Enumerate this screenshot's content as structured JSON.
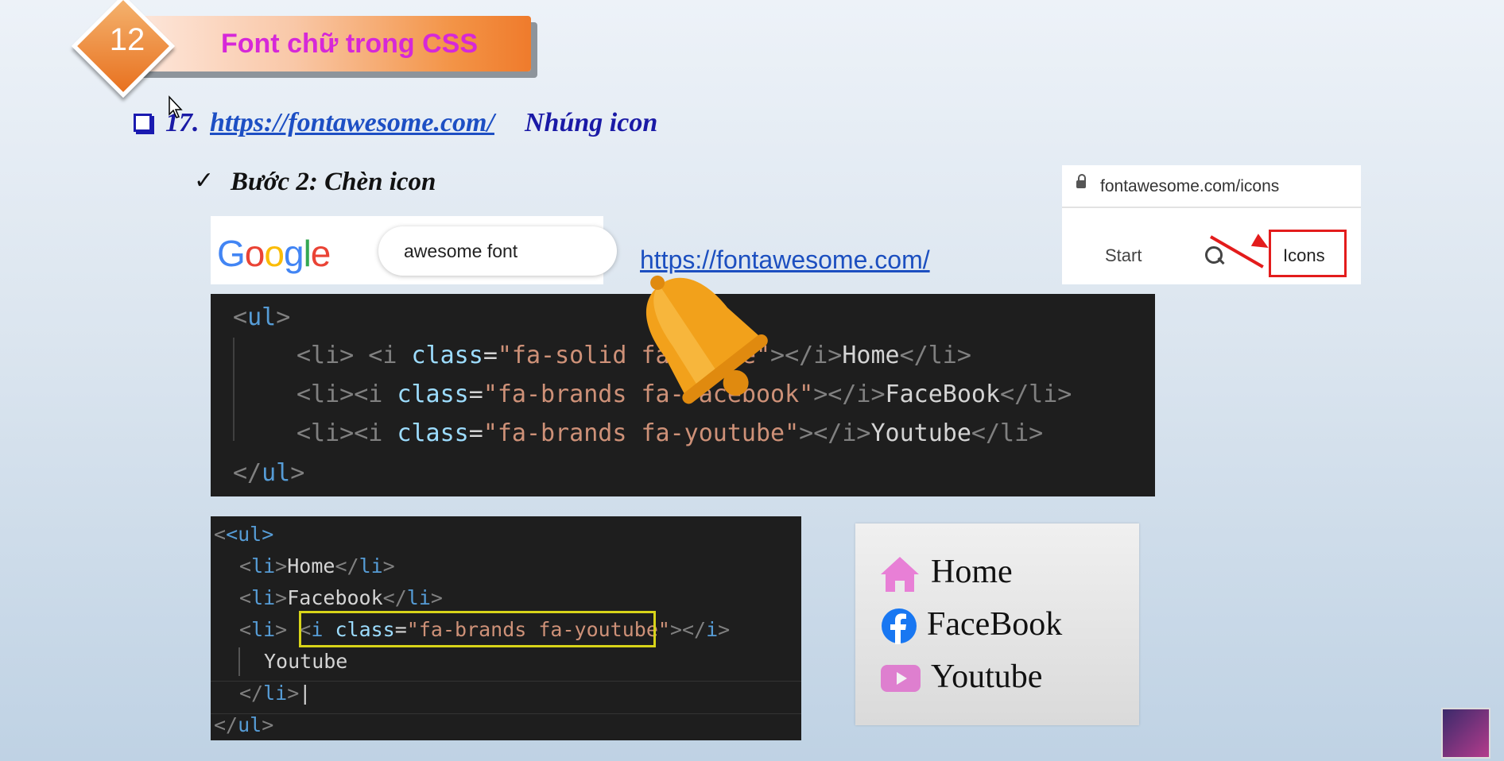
{
  "slide": {
    "number": "12",
    "title": "Font chữ trong CSS",
    "heading_number": "17.",
    "heading_link": "https://fontawesome.com/",
    "heading_rest": "Nhúng icon",
    "check_mark": "✓",
    "step": "Bước 2: Chèn icon"
  },
  "google": {
    "logo": "Google",
    "query": "awesome font"
  },
  "fontawesome_link": "https://fontawesome.com/",
  "fa_browser": {
    "url": "fontawesome.com/icons",
    "nav_start": "Start",
    "nav_icons": "Icons"
  },
  "code1": {
    "ul_open": "<ul>",
    "ul_close": "</ul>",
    "items": [
      {
        "prefix": "<li> <i ",
        "attr": "class",
        "value": "\"fa-solid fa-house\"",
        "suffix": "></i>",
        "text": "Home",
        "close": "</li>"
      },
      {
        "prefix": "<li><i ",
        "attr": "class",
        "value": "\"fa-brands fa-facebook\"",
        "suffix": "></i>",
        "text": "FaceBook",
        "close": "</li>"
      },
      {
        "prefix": "<li><i ",
        "attr": "class",
        "value": "\"fa-brands fa-youtube\"",
        "suffix": "></i>",
        "text": "Youtube",
        "close": "</li>"
      }
    ]
  },
  "code2": {
    "ul_open": "<ul>",
    "li1_text": "Home",
    "li2_text": "Facebook",
    "li3_open": "<li>",
    "i_tag": "<i class=\"fa-brands fa-youtube\">",
    "i_close": "</i>",
    "li3_text": "Youtube",
    "li3_close": "</li>",
    "ul_close": "</ul>"
  },
  "rendered": {
    "items": [
      "Home",
      "FaceBook",
      "Youtube"
    ]
  },
  "colors": {
    "title_text": "#d628d8",
    "heading": "#1a1aa6",
    "link": "#1d4fc4",
    "highlight_border": "#d8d419",
    "red_box": "#e31c1c",
    "icon_pink": "#e87fd6",
    "icon_facebook": "#1877f2"
  },
  "icons": [
    "house-icon",
    "facebook-icon",
    "youtube-icon",
    "bell-icon",
    "lock-icon",
    "search-icon"
  ]
}
